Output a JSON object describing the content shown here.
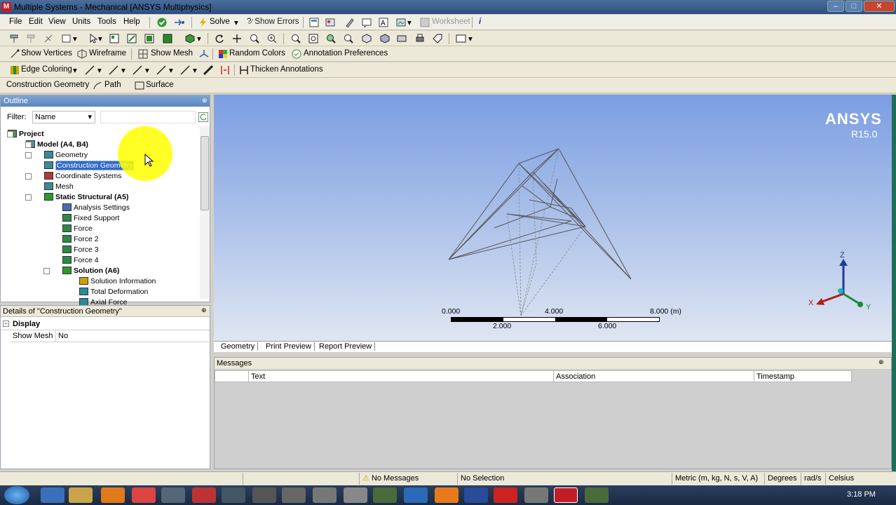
{
  "title": "Multiple Systems - Mechanical [ANSYS Multiphysics]",
  "window_buttons": [
    "–",
    "□",
    "✕"
  ],
  "menu": [
    "File",
    "Edit",
    "View",
    "Units",
    "Tools",
    "Help"
  ],
  "toolbar1": {
    "solve": "Solve",
    "show_errors": "Show Errors",
    "worksheet": "Worksheet"
  },
  "toolbar3": {
    "show_vertices": "Show Vertices",
    "wireframe": "Wireframe",
    "show_mesh": "Show Mesh",
    "random_colors": "Random Colors",
    "annotation_preferences": "Annotation Preferences"
  },
  "toolbar4": {
    "edge_coloring": "Edge Coloring",
    "thicken_annotations": "Thicken Annotations"
  },
  "toolbar5": {
    "construction_geometry": "Construction Geometry",
    "path": "Path",
    "surface": "Surface"
  },
  "outline": {
    "title": "Outline",
    "filter_label": "Filter:",
    "filter_value": "Name",
    "nodes": [
      {
        "label": "Project",
        "bold": true
      },
      {
        "label": "Model (A4, B4)",
        "bold": true
      },
      {
        "label": "Geometry"
      },
      {
        "label": "Construction Geometry",
        "selected": true
      },
      {
        "label": "Coordinate Systems"
      },
      {
        "label": "Mesh"
      },
      {
        "label": "Static Structural (A5)",
        "bold": true
      },
      {
        "label": "Analysis Settings"
      },
      {
        "label": "Fixed Support"
      },
      {
        "label": "Force"
      },
      {
        "label": "Force 2"
      },
      {
        "label": "Force 3"
      },
      {
        "label": "Force 4"
      },
      {
        "label": "Solution (A6)",
        "bold": true
      },
      {
        "label": "Solution Information"
      },
      {
        "label": "Total Deformation"
      },
      {
        "label": "Axial Force"
      }
    ]
  },
  "details": {
    "title": "Details of \"Construction Geometry\"",
    "group": "Display",
    "rows": [
      {
        "key": "Show Mesh",
        "value": "No"
      }
    ]
  },
  "viewport": {
    "brand": "ANSYS",
    "version": "R15.0",
    "scale_top": [
      "0.000",
      "4.000",
      "8.000 (m)"
    ],
    "scale_bottom": [
      "2.000",
      "6.000"
    ],
    "triad": {
      "z": "Z",
      "x": "X",
      "y": "Y"
    }
  },
  "view_tabs": [
    "Geometry",
    "Print Preview",
    "Report Preview"
  ],
  "messages": {
    "title": "Messages",
    "columns": [
      "Text",
      "Association",
      "Timestamp"
    ]
  },
  "status": {
    "messages": "No Messages",
    "selection": "No Selection",
    "units": "Metric (m, kg, N, s, V, A)",
    "angle": "Degrees",
    "rate": "rad/s",
    "temp": "Celsius"
  },
  "clock": "3:18 PM",
  "colors": {
    "titlebar": "#3a5d8c",
    "viewport_top": "#7b9ee3",
    "selection": "#3169c6",
    "highlight": "#ffff00",
    "ansys_red": "#c21d24"
  }
}
